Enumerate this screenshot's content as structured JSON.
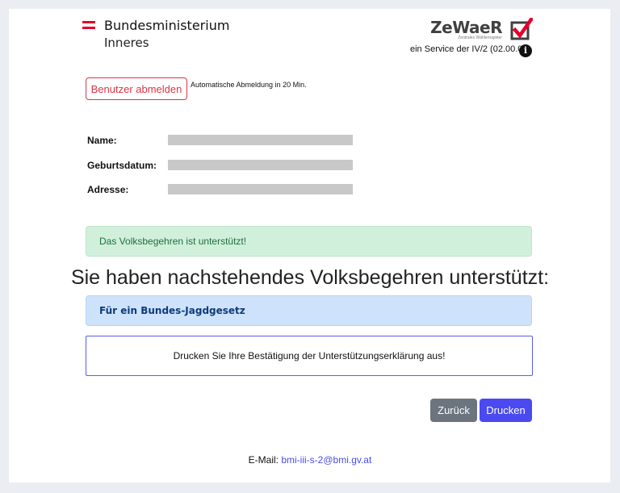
{
  "header": {
    "ministry_name": "Bundesministerium",
    "ministry_sub": "Inneres",
    "zewaer_logo_text": "ZeWaeR",
    "zewaer_tagline": "Zentrales Wählerregister",
    "service_text": "ein Service der IV/2 (02.00.00)",
    "info_icon_glyph": "i"
  },
  "session": {
    "logout_label": "Benutzer abmelden",
    "auto_logout_note": "Automatische Abmeldung in 20 Min."
  },
  "person": {
    "name_label": "Name:",
    "birthdate_label": "Geburtsdatum:",
    "address_label": "Adresse:"
  },
  "status": {
    "success_message": "Das Volksbegehren ist unterstützt!"
  },
  "main": {
    "headline": "Sie haben nachstehendes Volksbegehren unterstützt:",
    "initiative_title": "Für ein Bundes-Jagdgesetz",
    "print_note": "Drucken Sie Ihre Bestätigung der Unterstützungserklärung aus!"
  },
  "actions": {
    "back_label": "Zurück",
    "print_label": "Drucken"
  },
  "footer": {
    "email_label": "E-Mail:",
    "email_address": "bmi-iii-s-2@bmi.gv.at"
  },
  "colors": {
    "page_background": "#eaedf2",
    "danger": "#dc3545",
    "success_bg": "#d1f0dc",
    "info_bg": "#cfe2fc",
    "primary": "#4a4af0",
    "secondary": "#6c757d",
    "flag_red": "#e4002b"
  },
  "icons": [
    "austria-flag-icon",
    "zewaer-check-icon",
    "info-icon"
  ]
}
